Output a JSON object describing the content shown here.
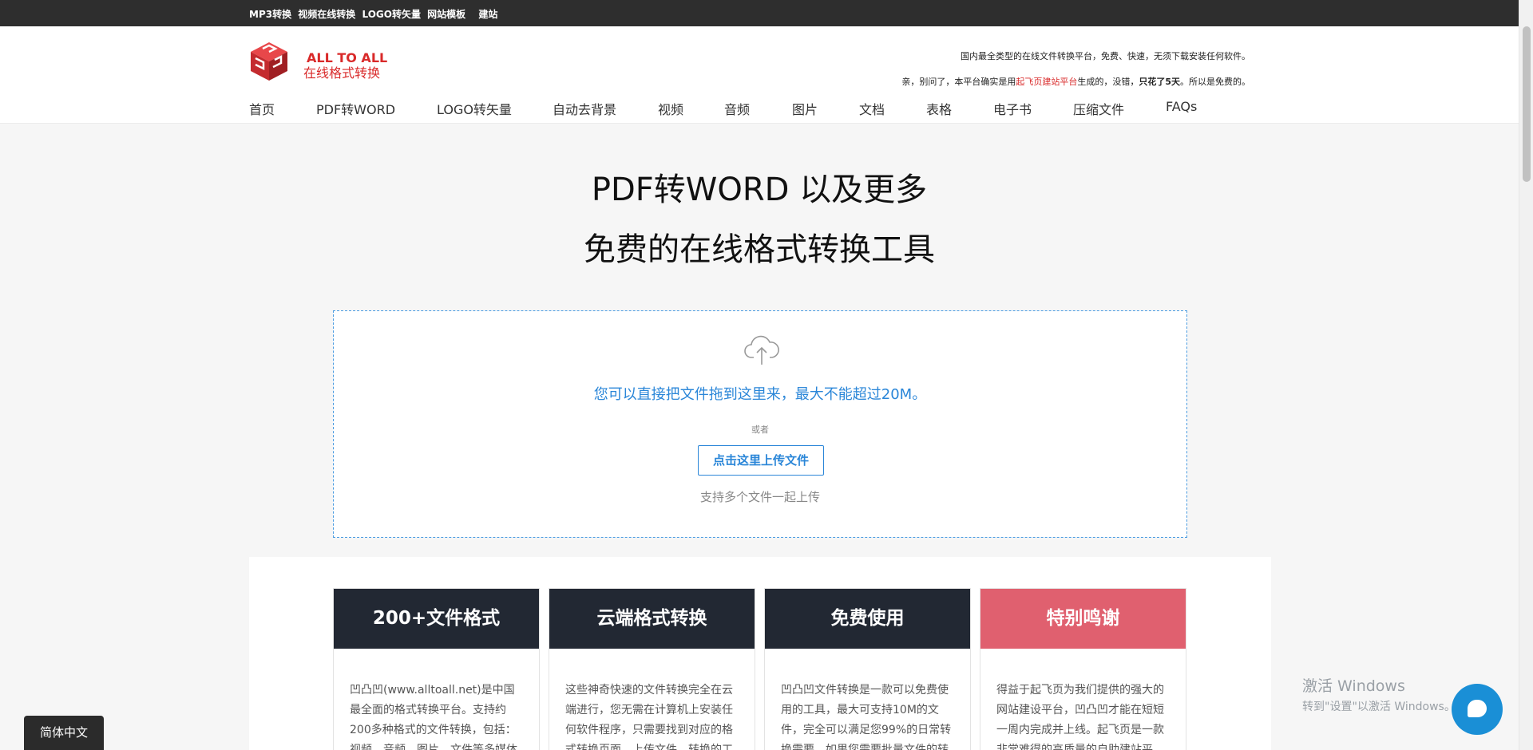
{
  "topbar": {
    "links": [
      "MP3转换",
      "视频在线转换",
      "LOGO转矢量",
      "网站模板",
      "建站"
    ]
  },
  "brand": {
    "name_en": "ALL TO ALL",
    "name_cn": "在线格式转换"
  },
  "slogan": {
    "line1": "国内最全类型的在线文件转换平台，免费、快速，无须下载安装任何软件。",
    "line2_pre": "亲，别问了，本平台确实是用",
    "line2_red": "起飞页建站平台",
    "line2_mid": "生成的，没错，",
    "line2_bold": "只花了5天",
    "line2_post": "。所以是免费的。"
  },
  "nav": [
    "首页",
    "PDF转WORD",
    "LOGO转矢量",
    "自动去背景",
    "视频",
    "音频",
    "图片",
    "文档",
    "表格",
    "电子书",
    "压缩文件",
    "FAQs"
  ],
  "hero": {
    "title1": "PDF转WORD 以及更多",
    "title2": "免费的在线格式转换工具"
  },
  "upload": {
    "drag_text": "您可以直接把文件拖到这里来，最大不能超过20M。",
    "or_text": "或者",
    "button_label": "点击这里上传文件",
    "multi_text": "支持多个文件一起上传"
  },
  "features": [
    {
      "title": "200+文件格式",
      "text": "凹凸凹(www.alltoall.net)是中国最全面的格式转换平台。支持约200多种格式的文件转换，包括：视频、音频、图片、文件等多媒体文"
    },
    {
      "title": "云端格式转换",
      "text": "这些神奇快速的文件转换完全在云端进行，您无需在计算机上安装任何软件程序，只需要找到对应的格式转换页面，上传文件，转换的工"
    },
    {
      "title": "免费使用",
      "text": "凹凸凹文件转换是一款可以免费使用的工具，最大可支持10M的文件，完全可以满足您99%的日常转换需要，如果您需要批量文件的转"
    },
    {
      "title": "特别鸣谢",
      "text": "得益于起飞页为我们提供的强大的网站建设平台，凹凸凹才能在短短一周内完成并上线。起飞页是一款非常难得的高质量的自助建站平"
    }
  ],
  "watermark": {
    "line1": "激活 Windows",
    "line2": "转到\"设置\"以激活 Windows。"
  },
  "lang_button": "简体中文",
  "colors": {
    "brand_red": "#d92a2a",
    "accent_blue": "#2a86d8",
    "card_dark": "#222833",
    "card_pink": "#e0606f"
  }
}
